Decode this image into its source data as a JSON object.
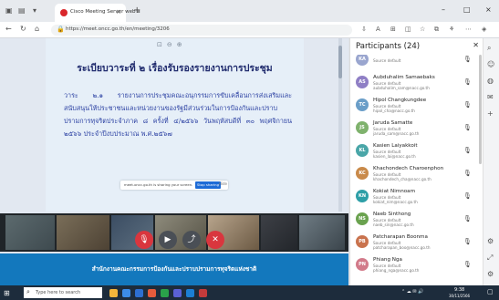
{
  "browser": {
    "tab_title": "Cisco Meeting Server web a",
    "tab_close": "×",
    "new_tab": "+",
    "url": "https://meet.oncc.go.th/en/meeting/3206",
    "window_controls": [
      "–",
      "□",
      "×"
    ]
  },
  "slide": {
    "title": "ระเบียบวาระที่ ๒     เรื่องรับรองรายงานการประชุม",
    "body": "วาระ ๒.๑    รายงานการประชุมคณะอนุกรรมการขับเคลื่อนการส่งเสริมและสนับสนุนให้ประชาชนและหน่วยงานของรัฐมีส่วนร่วมในการป้องกันและปราบปรามการทุจริตประจำภาค ๘ ครั้งที่ ๔/๒๕๖๖ วันพฤหัสบดีที่ ๓๐ พฤศจิกายน ๒๕๖๖ ประจำปีงบประมาณ พ.ศ.๒๕๖๗",
    "share_msg": "meet.oncc.go.th is sharing your screen.",
    "share_button": "Stop sharing",
    "hide_label": "Hide"
  },
  "banner": {
    "text": "สำนักงานคณะกรรมการป้องกันและปราบปรามการทุจริตแห่งชาติ"
  },
  "participants": {
    "title": "Participants (24)",
    "list": [
      {
        "initials": "KA",
        "name": "",
        "sub": "Source default",
        "email": "",
        "color": "#9aa6cf"
      },
      {
        "initials": "AS",
        "name": "Aubduhalim Samaebaks",
        "sub": "Source default",
        "email": "aubduhalim_sam@nacc.go.th",
        "color": "#8f7fc5"
      },
      {
        "initials": "TC",
        "name": "Hipol Changkungdee",
        "sub": "Source default",
        "email": "hipol_cha@nacc.go.th",
        "color": "#6a9ec8"
      },
      {
        "initials": "JS",
        "name": "Jaruda Samatte",
        "sub": "Source default",
        "email": "jaruda_sam@nacc.go.th",
        "color": "#7fb26d"
      },
      {
        "initials": "KL",
        "name": "Kasien Laiyakkoit",
        "sub": "Source default",
        "email": "kasien_lai@nacc.go.th",
        "color": "#4aa6a8"
      },
      {
        "initials": "KC",
        "name": "Khachondech Charoenphon",
        "sub": "Source default",
        "email": "khachondech_cha@nacc.go.th",
        "color": "#c98a4a"
      },
      {
        "initials": "KN",
        "name": "Kokiat Nimnoam",
        "sub": "Source default",
        "email": "kokiat_nim@nacc.go.th",
        "color": "#2e9fa7"
      },
      {
        "initials": "NS",
        "name": "Naeb Sinthong",
        "sub": "Source default",
        "email": "naeb_sin@nacc.go.th",
        "color": "#6aa24f"
      },
      {
        "initials": "PB",
        "name": "Patcharapan Boonma",
        "sub": "Source default",
        "email": "patcharapan_boo@nacc.go.th",
        "color": "#c9734e"
      },
      {
        "initials": "PN",
        "name": "Phiang Nga",
        "sub": "Source default",
        "email": "phiang_nga@nacc.go.th",
        "color": "#d27a8a"
      }
    ]
  },
  "taskbar": {
    "search_placeholder": "Type here to search",
    "time": "9:38",
    "date": "30/11/2566"
  },
  "controls": {
    "mic_icon": "mic",
    "camera_icon": "camera",
    "share_icon": "share",
    "leave_icon": "hang-up"
  }
}
